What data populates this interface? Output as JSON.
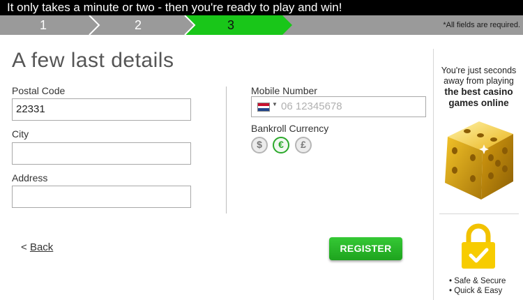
{
  "banner": {
    "text": "It only takes a minute or two - then you're ready to play and win!"
  },
  "steps": {
    "items": [
      {
        "label": "1",
        "state": "done"
      },
      {
        "label": "2",
        "state": "done"
      },
      {
        "label": "3",
        "state": "active"
      }
    ],
    "active_color": "#19c619",
    "required_note": "*All fields are required."
  },
  "form": {
    "title": "A few last details",
    "postal_code": {
      "label": "Postal Code",
      "value": "22331"
    },
    "city": {
      "label": "City",
      "value": ""
    },
    "address": {
      "label": "Address",
      "value": ""
    },
    "mobile": {
      "label": "Mobile Number",
      "placeholder": "06 12345678",
      "country_flag": "nl-flag-icon"
    },
    "currency": {
      "label": "Bankroll Currency",
      "options": [
        "$",
        "€",
        "£"
      ],
      "selected": "€"
    },
    "back_label": "Back",
    "back_prefix": "<",
    "register_label": "REGISTER"
  },
  "side": {
    "line1": "You're just seconds away from playing",
    "line2": "the best casino games online",
    "bullets": [
      "• Safe & Secure",
      "• Quick & Easy"
    ],
    "dice_icon": "golden-dice-icon",
    "lock_icon": "padlock-check-icon"
  },
  "colors": {
    "accent_green": "#1ea31e",
    "banner_bg": "#000000",
    "steps_bg": "#9a9a9a",
    "gold": "#e8b718"
  }
}
